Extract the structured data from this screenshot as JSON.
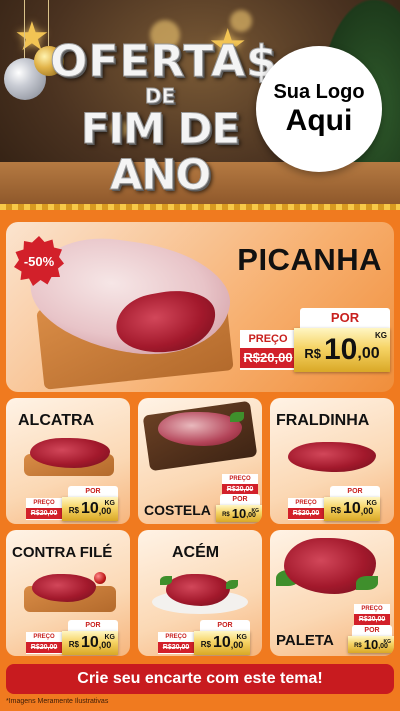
{
  "header": {
    "title_line1": "OFERTA$",
    "title_line2": "DE",
    "title_line3": "FIM DE ANO",
    "logo_line1": "Sua Logo",
    "logo_line2": "Aqui"
  },
  "featured": {
    "badge": "-50%",
    "name": "PICANHA",
    "por_label": "POR",
    "preco_label": "PREÇO",
    "old_price": "R$20,00",
    "currency": "R$",
    "price_int": "10",
    "price_dec": ",00",
    "unit": "KG"
  },
  "products": [
    {
      "name": "ALCATRA",
      "por_label": "POR",
      "preco_label": "PREÇO",
      "old_price": "R$20,00",
      "currency": "R$",
      "price_int": "10",
      "price_dec": ",00",
      "unit": "KG"
    },
    {
      "name": "COSTELA",
      "por_label": "POR",
      "preco_label": "PREÇO",
      "old_price": "R$20,00",
      "currency": "R$",
      "price_int": "10",
      "price_dec": ",00",
      "unit": "KG"
    },
    {
      "name": "FRALDINHA",
      "por_label": "POR",
      "preco_label": "PREÇO",
      "old_price": "R$20,00",
      "currency": "R$",
      "price_int": "10",
      "price_dec": ",00",
      "unit": "KG"
    },
    {
      "name": "CONTRA FILÉ",
      "por_label": "POR",
      "preco_label": "PREÇO",
      "old_price": "R$20,00",
      "currency": "R$",
      "price_int": "10",
      "price_dec": ",00",
      "unit": "KG"
    },
    {
      "name": "ACÉM",
      "por_label": "POR",
      "preco_label": "PREÇO",
      "old_price": "R$20,00",
      "currency": "R$",
      "price_int": "10",
      "price_dec": ",00",
      "unit": "KG"
    },
    {
      "name": "PALETA",
      "por_label": "POR",
      "preco_label": "PREÇO",
      "old_price": "R$20,00",
      "currency": "R$",
      "price_int": "10",
      "price_dec": ",00",
      "unit": "KG"
    }
  ],
  "cta": {
    "label": "Crie seu encarte com este tema!"
  },
  "disclaimer": "*Imagens Meramente Ilustrativas",
  "colors": {
    "background": "#f07a1f",
    "accent_red": "#c81b1f",
    "price_gold": "#f6d466",
    "header_brown": "#4a3220"
  },
  "icons": [
    "ornament-silver",
    "ornament-gold",
    "star",
    "christmas-tree"
  ]
}
